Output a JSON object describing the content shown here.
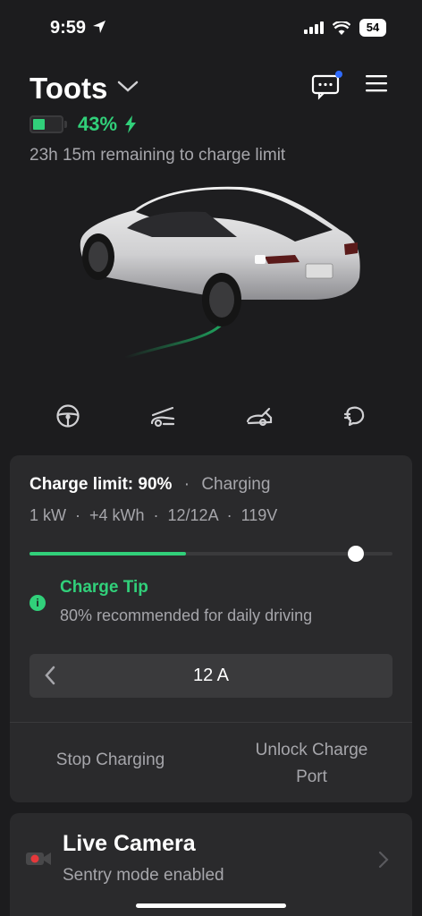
{
  "status_bar": {
    "time": "9:59",
    "battery": "54"
  },
  "header": {
    "car_name": "Toots",
    "battery_percent": "43%",
    "battery_level": 0.43,
    "remaining": "23h 15m remaining to charge limit"
  },
  "quick_controls": [
    {
      "icon": "steering-wheel-icon"
    },
    {
      "icon": "frunk-icon"
    },
    {
      "icon": "trunk-icon"
    },
    {
      "icon": "charge-port-icon"
    }
  ],
  "charge": {
    "limit_label": "Charge limit: 90%",
    "separator": "·",
    "state": "Charging",
    "stats": "1 kW  ·  +4 kWh  ·  12/12A  ·  119V",
    "current_level": 0.43,
    "limit_level": 0.9,
    "tip_icon": "i",
    "tip_title": "Charge Tip",
    "tip_body": "80% recommended for daily driving",
    "amps": "12 A",
    "stop_label": "Stop Charging",
    "unlock_label": "Unlock Charge Port"
  },
  "camera": {
    "title": "Live Camera",
    "subtitle": "Sentry mode enabled"
  },
  "colors": {
    "background": "#1c1c1e",
    "card": "#2a2a2c",
    "accent_green": "#31d07a",
    "notification_dot": "#2f6bff",
    "camera_red": "#e5383b"
  }
}
